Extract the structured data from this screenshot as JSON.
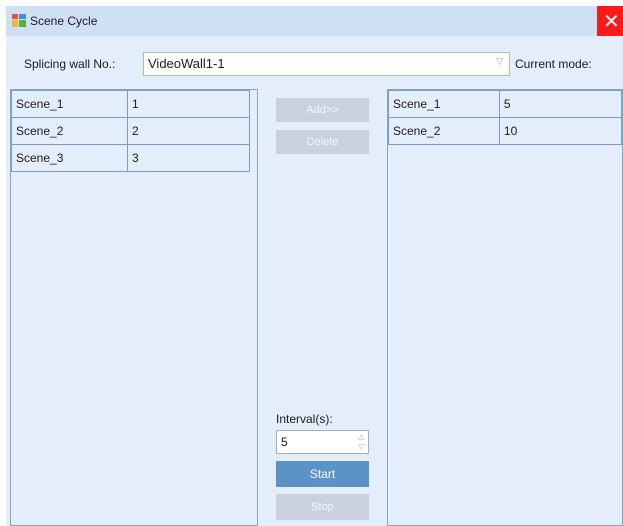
{
  "window": {
    "title": "Scene Cycle",
    "close_glyph": "✕"
  },
  "header": {
    "wall_label": "Splicing wall No.:",
    "wall_value": "VideoWall1-1",
    "dropdown_glyph": "▽",
    "mode_label": "Current mode:"
  },
  "left_table": {
    "rows": [
      [
        "Scene_1",
        "1"
      ],
      [
        "Scene_2",
        "2"
      ],
      [
        "Scene_3",
        "3"
      ]
    ]
  },
  "right_table": {
    "rows": [
      [
        "Scene_1",
        "5"
      ],
      [
        "Scene_2",
        "10"
      ]
    ]
  },
  "buttons": {
    "add": "Add>>",
    "delete": "Delete",
    "start": "Start",
    "stop": "Stop"
  },
  "interval": {
    "label": "Interval(s):",
    "value": "5",
    "up_glyph": "△",
    "down_glyph": "▽"
  },
  "colors": {
    "titlebar": "#cfe0f5",
    "window_bg": "#e4eefa",
    "close": "#ff1a1a",
    "primary_button": "#5a93c8",
    "disabled_button": "#c8d1dd"
  }
}
